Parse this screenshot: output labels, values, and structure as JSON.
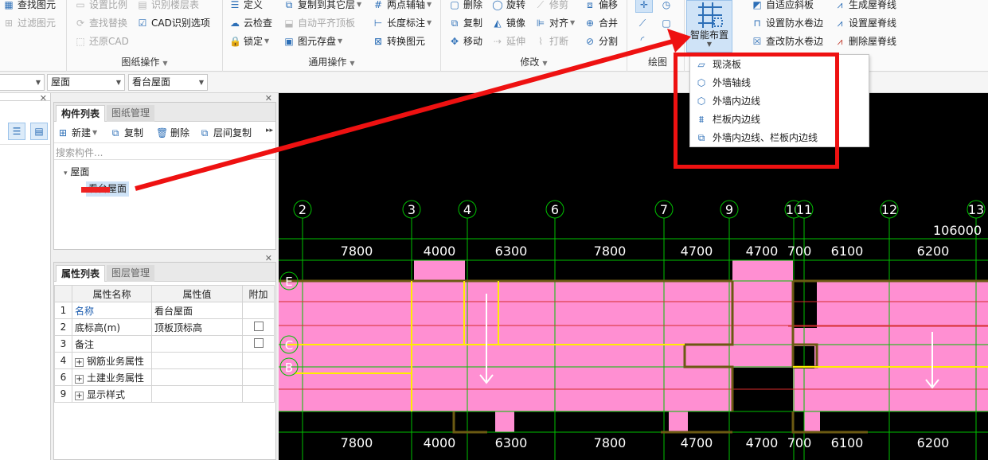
{
  "ribbon": {
    "groups": {
      "drawing_ops": "图纸操作",
      "common_ops": "通用操作",
      "modify": "修改",
      "draw": "绘图"
    },
    "items": {
      "find_element": "查找图元",
      "filter_element": "过滤图元",
      "set_scale": "设置比例",
      "find_replace": "查找替换",
      "restore_cad": "还原CAD",
      "identify_floor_table": "识别楼层表",
      "cad_options": "CAD识别选项",
      "define": "定义",
      "cloud_check": "云检查",
      "lock": "锁定",
      "copy_to_layer": "复制到其它层",
      "auto_flat_roof": "自动平齐顶板",
      "element_save": "图元存盘",
      "two_point_axis": "两点辅轴",
      "length_dim": "长度标注",
      "convert_element": "转换图元",
      "delete": "删除",
      "rotate": "旋转",
      "trim": "修剪",
      "offset": "偏移",
      "copy": "复制",
      "mirror": "镜像",
      "align": "对齐",
      "merge": "合并",
      "move": "移动",
      "extend": "延伸",
      "break": "打断",
      "split": "分割",
      "smart_layout": "智能布置",
      "auto_slope": "自适应斜板",
      "set_waterproof": "设置防水卷边",
      "check_waterproof": "查改防水卷边",
      "gen_ridge": "生成屋脊线",
      "set_ridge": "设置屋脊线",
      "del_ridge": "删除屋脊线"
    }
  },
  "selectors": {
    "floor_type": "屋面",
    "component": "看台屋面"
  },
  "component_panel": {
    "tabs": [
      "构件列表",
      "图纸管理"
    ],
    "toolbar": {
      "new": "新建",
      "copy": "复制",
      "delete": "删除",
      "copy_between_floors": "层间复制"
    },
    "search_placeholder": "搜索构件...",
    "tree_root": "屋面",
    "tree_child": "看台屋面"
  },
  "property_panel": {
    "tabs": [
      "属性列表",
      "图层管理"
    ],
    "headers": [
      "属性名称",
      "属性值",
      "附加"
    ],
    "rows": [
      {
        "no": "1",
        "name": "名称",
        "value": "看台屋面"
      },
      {
        "no": "2",
        "name": "底标高(m)",
        "value": "顶板顶标高"
      },
      {
        "no": "3",
        "name": "备注",
        "value": ""
      },
      {
        "no": "4",
        "name": "钢筋业务属性",
        "value": ""
      },
      {
        "no": "6",
        "name": "土建业务属性",
        "value": ""
      },
      {
        "no": "9",
        "name": "显示样式",
        "value": ""
      }
    ]
  },
  "smart_dropdown": [
    "现浇板",
    "外墙轴线",
    "外墙内边线",
    "栏板内边线",
    "外墙内边线、栏板内边线"
  ],
  "drawing": {
    "axes_top": [
      "2",
      "3",
      "4",
      "6",
      "7",
      "9",
      "10",
      "11",
      "12",
      "13"
    ],
    "total_dim": "106000",
    "dims_top": [
      "7800",
      "4000",
      "6300",
      "7800",
      "4700",
      "4700",
      "700",
      "6100",
      "6200"
    ],
    "dims_bottom": [
      "7800",
      "4000",
      "6300",
      "7800",
      "4700",
      "4700",
      "700",
      "6100",
      "6200"
    ],
    "axes_side": [
      "E",
      "C",
      "B"
    ]
  },
  "colors": {
    "canvas_bg": "#000000",
    "slab_fill": "#ff8fd2",
    "grid": "#00c000",
    "wall": "#6b5a12",
    "highlight": "#ffee00",
    "annotation": "#ee1111"
  }
}
